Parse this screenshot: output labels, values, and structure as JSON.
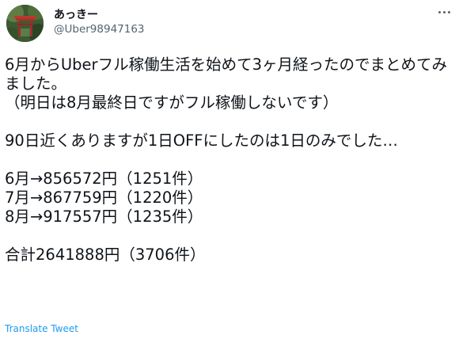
{
  "author": {
    "display_name": "あっきー",
    "handle": "@Uber98947163",
    "avatar_icon": "avatar-photo"
  },
  "menu": {
    "icon": "more-options-icon"
  },
  "tweet": {
    "text": "6月からUberフル稼働生活を始めて3ヶ月経ったのでまとめてみました。\n（明日は8月最終日ですがフル稼働しないです）\n\n90日近くありますが1日OFFにしたのは1日のみでした…\n\n6月→856572円（1251件）\n7月→867759円（1220件）\n8月→917557円（1235件）\n\n合計2641888円（3706件）"
  },
  "footer": {
    "translate_label": "Translate Tweet"
  },
  "colors": {
    "text": "#0f1419",
    "secondary": "#536471",
    "link": "#1d9bf0"
  }
}
